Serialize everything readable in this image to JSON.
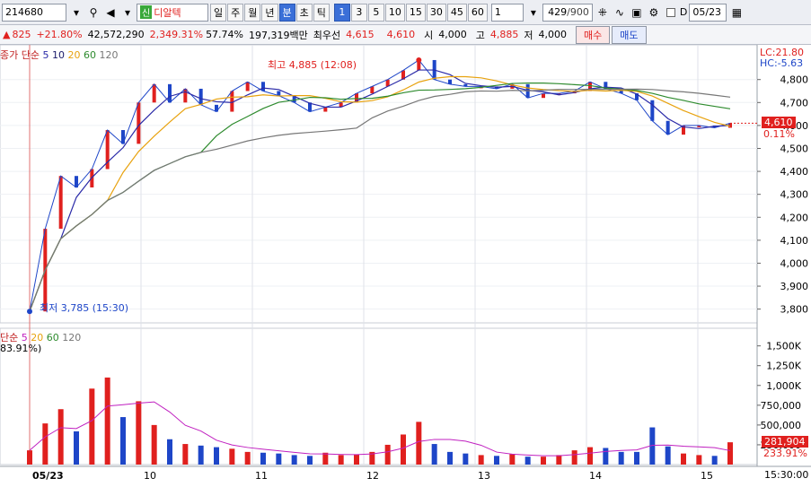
{
  "toolbar": {
    "code": "214680",
    "badge": "신",
    "name": "디알텍",
    "periods": [
      "일",
      "주",
      "월",
      "년",
      "분",
      "초",
      "틱"
    ],
    "active_period": "분",
    "intervals": [
      "1",
      "3",
      "5",
      "10",
      "15",
      "30",
      "45",
      "60"
    ],
    "active_interval": "1",
    "unit_value": "1",
    "count": "429",
    "count_total": "/900",
    "date_label": "D",
    "date_value": "05/23"
  },
  "quote": {
    "change": "825",
    "change_pct": "+21.80%",
    "volume": "42,572,290",
    "volume_pct": "2,349.31%",
    "turnover_pct": "57.74%",
    "amount": "197,319백만",
    "priority_label": "최우선",
    "ask": "4,615",
    "bid": "4,610",
    "open_label": "시",
    "open": "4,000",
    "high_label": "고",
    "high": "4,885",
    "low_label": "저",
    "low": "4,000",
    "buy_label": "매수",
    "sell_label": "매도"
  },
  "legend": {
    "price_title": "종가 단순",
    "ma": [
      "5",
      "10",
      "20",
      "60",
      "120"
    ],
    "volume_title": "단순",
    "volume_ma": [
      "5",
      "20",
      "60",
      "120"
    ],
    "volume_pct": "83.91%)"
  },
  "annotations": {
    "high": "최고 4,885 (12:08)",
    "low": "최저 3,785 (15:30)",
    "lc": "LC:21.80",
    "hc": "HC:-5.63",
    "current_price": "4,610",
    "current_pct": "0.11%",
    "current_volume": "281,904",
    "current_volume_pct": "233.91%",
    "time_last": "15:30:00"
  },
  "colors": {
    "up": "#e0201e",
    "down": "#1e46c8",
    "ma5": "#2a2aa8",
    "ma10": "#1a1a6a",
    "ma20": "#e8a20e",
    "ma60": "#2e8b2e",
    "ma120": "#777777",
    "price_box": "#e0201e"
  },
  "chart_data": {
    "type": "line",
    "title": "",
    "price_axis": {
      "ticks": [
        "4,800",
        "4,700",
        "4,600",
        "4,500",
        "4,400",
        "4,300",
        "4,200",
        "4,100",
        "4,000",
        "3,900",
        "3,800"
      ],
      "range": [
        3740,
        4920
      ]
    },
    "volume_axis": {
      "ticks": [
        "1,500K",
        "1,250K",
        "1,000K",
        "750,000",
        "500,000",
        "250,000"
      ],
      "range": [
        0,
        1700000
      ]
    },
    "x_ticks": [
      "05/23",
      "10",
      "11",
      "12",
      "13",
      "14",
      "15"
    ],
    "price_series": {
      "name": "종가",
      "x": [
        "09:00",
        "09:05",
        "09:10",
        "09:15",
        "09:20",
        "09:25",
        "09:30",
        "09:35",
        "09:40",
        "09:45",
        "09:50",
        "09:55",
        "10:00",
        "10:10",
        "10:20",
        "10:30",
        "10:40",
        "10:50",
        "11:00",
        "11:10",
        "11:20",
        "11:30",
        "11:40",
        "11:50",
        "12:00",
        "12:08",
        "12:20",
        "12:30",
        "12:40",
        "12:50",
        "13:00",
        "13:10",
        "13:20",
        "13:30",
        "13:40",
        "13:50",
        "14:00",
        "14:10",
        "14:20",
        "14:30",
        "14:40",
        "14:50",
        "15:00",
        "15:10",
        "15:20",
        "15:30"
      ],
      "values": [
        3790,
        4150,
        4380,
        4330,
        4410,
        4580,
        4520,
        4700,
        4780,
        4700,
        4760,
        4690,
        4660,
        4750,
        4790,
        4750,
        4730,
        4700,
        4660,
        4680,
        4700,
        4740,
        4770,
        4800,
        4840,
        4885,
        4800,
        4780,
        4770,
        4770,
        4760,
        4780,
        4720,
        4740,
        4740,
        4750,
        4790,
        4760,
        4740,
        4710,
        4620,
        4560,
        4600,
        4600,
        4590,
        4610
      ]
    },
    "volume_series": {
      "name": "거래량",
      "values": [
        180000,
        520000,
        700000,
        420000,
        960000,
        1100000,
        600000,
        800000,
        500000,
        320000,
        260000,
        240000,
        220000,
        200000,
        160000,
        150000,
        140000,
        120000,
        110000,
        150000,
        120000,
        130000,
        160000,
        250000,
        380000,
        540000,
        260000,
        160000,
        140000,
        120000,
        110000,
        130000,
        100000,
        100000,
        120000,
        180000,
        220000,
        210000,
        160000,
        160000,
        470000,
        230000,
        140000,
        120000,
        110000,
        281904
      ]
    },
    "xlabel": "",
    "ylabel": ""
  }
}
